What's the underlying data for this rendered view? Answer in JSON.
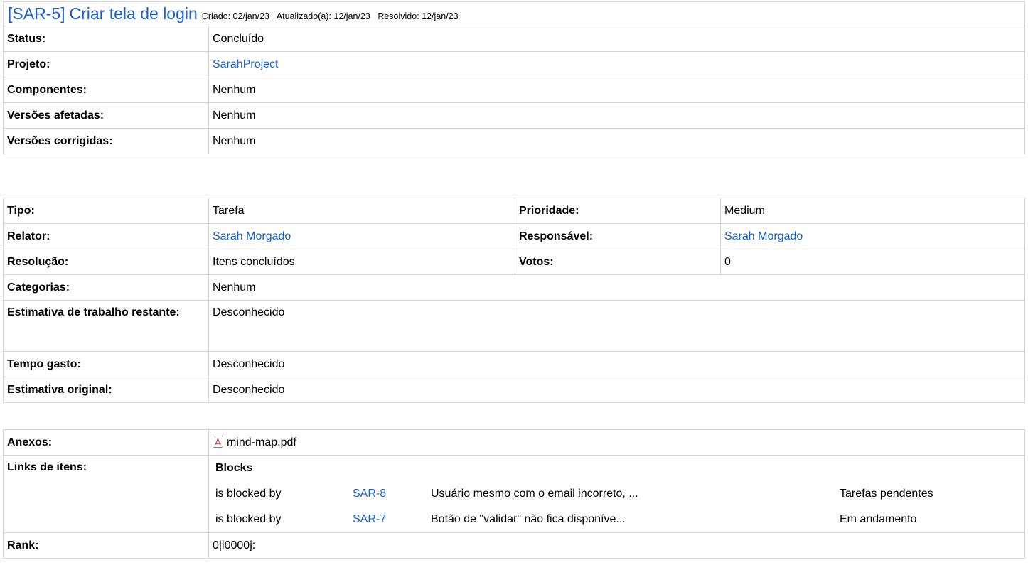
{
  "issue": {
    "key": "[SAR-5]",
    "title": "Criar tela de login",
    "created": "Criado: 02/jan/23",
    "updated": "Atualizado(a): 12/jan/23",
    "resolved": "Resolvido: 12/jan/23"
  },
  "summary": [
    {
      "label": "Status:",
      "value": "Concluído",
      "link": false
    },
    {
      "label": "Projeto:",
      "value": "SarahProject",
      "link": true
    },
    {
      "label": "Componentes:",
      "value": "Nenhum",
      "link": false
    },
    {
      "label": "Versões afetadas:",
      "value": "Nenhum",
      "link": false
    },
    {
      "label": "Versões corrigidas:",
      "value": "Nenhum",
      "link": false
    }
  ],
  "details": {
    "tipo": {
      "label": "Tipo:",
      "value": "Tarefa"
    },
    "prioridade": {
      "label": "Prioridade:",
      "value": "Medium"
    },
    "relator": {
      "label": "Relator:",
      "value": "Sarah Morgado"
    },
    "responsavel": {
      "label": "Responsável:",
      "value": "Sarah Morgado"
    },
    "resolucao": {
      "label": "Resolução:",
      "value": "Itens concluídos"
    },
    "votos": {
      "label": "Votos:",
      "value": "0"
    },
    "categorias": {
      "label": "Categorias:",
      "value": "Nenhum"
    },
    "estimativa_restante": {
      "label": "Estimativa de trabalho restante:",
      "value": "Desconhecido"
    },
    "tempo_gasto": {
      "label": "Tempo gasto:",
      "value": "Desconhecido"
    },
    "estimativa_original": {
      "label": "Estimativa original:",
      "value": "Desconhecido"
    }
  },
  "extras": {
    "anexos": {
      "label": "Anexos:",
      "file": "mind-map.pdf",
      "icon": "pdf-icon"
    },
    "links": {
      "label": "Links de itens:",
      "group": "Blocks",
      "items": [
        {
          "relation": "is blocked by",
          "key": "SAR-8",
          "summary": "Usuário mesmo com o email incorreto, ...",
          "status": "Tarefas pendentes"
        },
        {
          "relation": "is blocked by",
          "key": "SAR-7",
          "summary": "Botão de \"validar\" não fica disponíve...",
          "status": "Em andamento"
        }
      ]
    },
    "rank": {
      "label": "Rank:",
      "value": "0|i0000j:"
    }
  }
}
